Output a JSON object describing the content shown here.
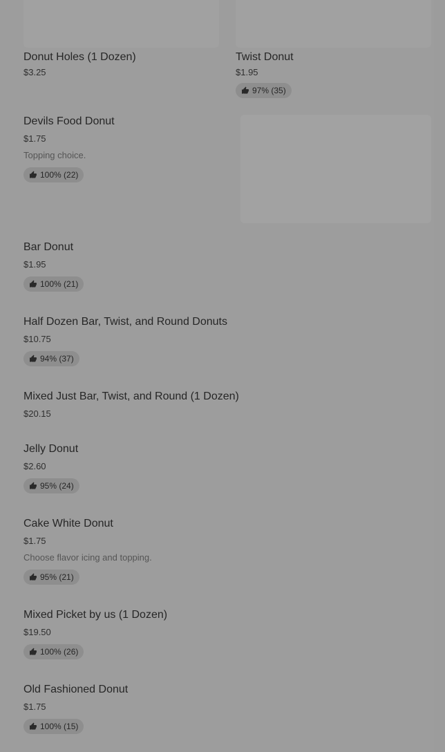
{
  "top_cards": [
    {
      "name": "Donut Holes (1 Dozen)",
      "price": "$3.25"
    },
    {
      "name": "Twist Donut",
      "price": "$1.95",
      "rating": "97% (35)"
    }
  ],
  "items": [
    {
      "name": "Devils Food Donut",
      "price": "$1.75",
      "description": "Topping choice.",
      "rating": "100% (22)"
    },
    {
      "name": "Bar Donut",
      "price": "$1.95",
      "rating": "100% (21)"
    },
    {
      "name": "Half Dozen Bar, Twist, and Round Donuts",
      "price": "$10.75",
      "rating": "94% (37)"
    },
    {
      "name": "Mixed Just Bar, Twist, and Round (1 Dozen)",
      "price": "$20.15"
    },
    {
      "name": "Jelly Donut",
      "price": "$2.60",
      "rating": "95% (24)"
    },
    {
      "name": "Cake White Donut",
      "price": "$1.75",
      "description": "Choose flavor icing and topping.",
      "rating": "95% (21)"
    },
    {
      "name": "Mixed Picket by us (1 Dozen)",
      "price": "$19.50",
      "rating": "100% (26)"
    },
    {
      "name": "Old Fashioned Donut",
      "price": "$1.75",
      "rating": "100% (15)"
    }
  ],
  "icons": {
    "rating_icon": "thumbs-up-icon"
  }
}
